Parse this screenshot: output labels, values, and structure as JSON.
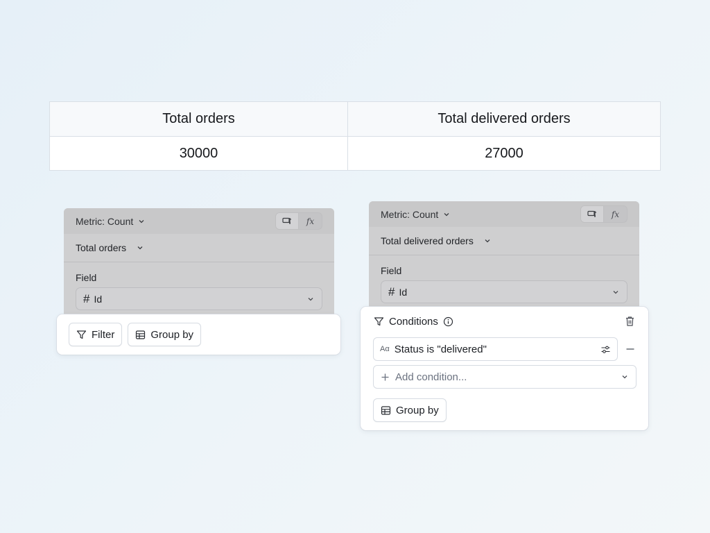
{
  "summary": {
    "headers": [
      "Total orders",
      "Total delivered orders"
    ],
    "values": [
      "30000",
      "27000"
    ]
  },
  "card_left": {
    "metric_label": "Metric: Count",
    "metric_name": "Total orders",
    "field_label": "Field",
    "field_value": "Id",
    "field_type_symbol": "#"
  },
  "card_right": {
    "metric_label": "Metric: Count",
    "metric_name": "Total delivered orders",
    "field_label": "Field",
    "field_value": "Id",
    "field_type_symbol": "#"
  },
  "panel_left": {
    "filter_label": "Filter",
    "group_by_label": "Group by"
  },
  "panel_right": {
    "conditions_title": "Conditions",
    "condition_type_symbol": "Aα",
    "condition_text": "Status is \"delivered\"",
    "add_condition_placeholder": "Add condition...",
    "group_by_label": "Group by"
  },
  "icons": {
    "formula_symbol": "fx"
  }
}
